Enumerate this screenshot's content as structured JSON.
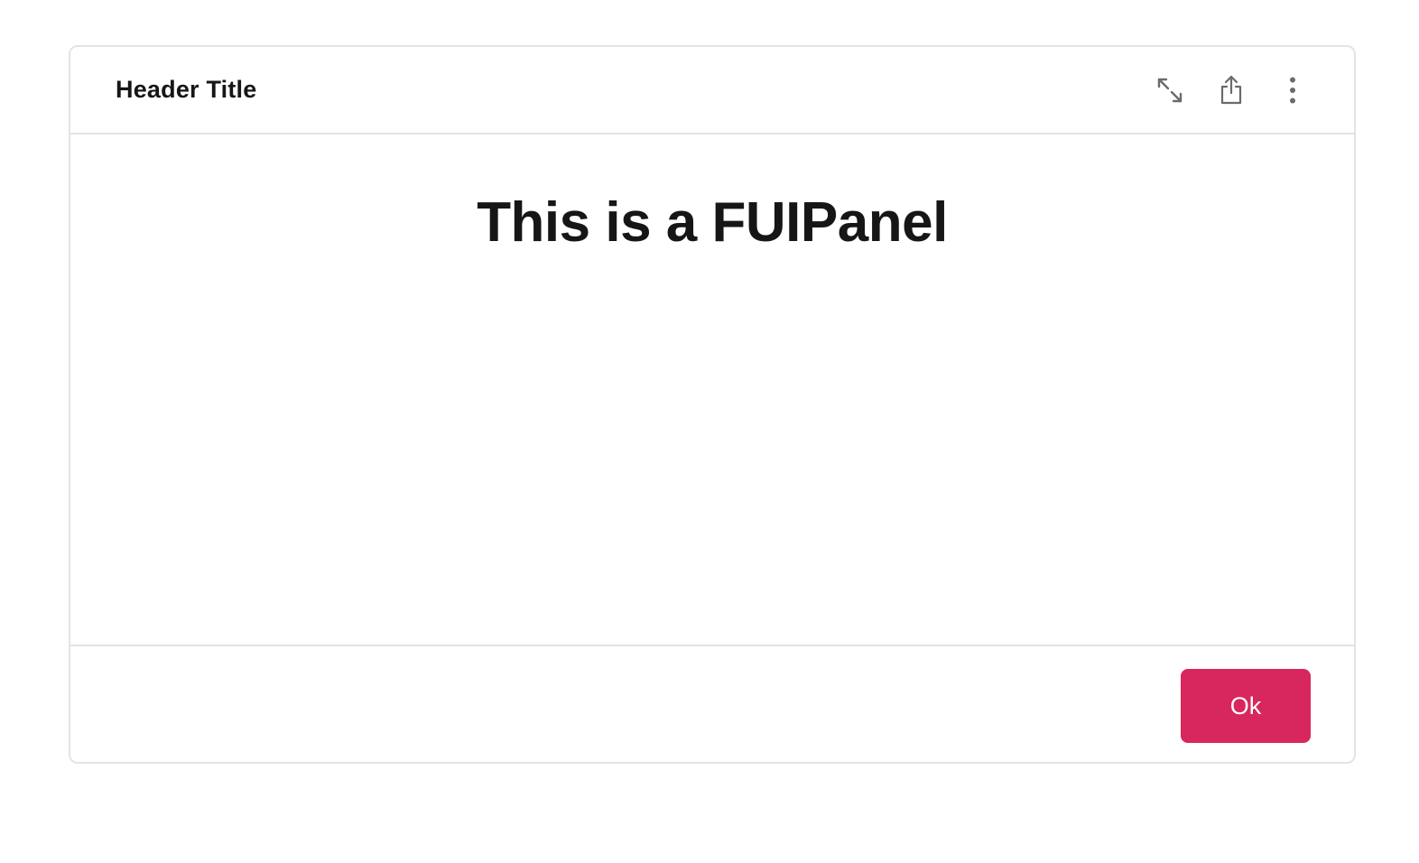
{
  "panel": {
    "header": {
      "title": "Header Title",
      "actions": [
        {
          "icon": "expand-icon"
        },
        {
          "icon": "share-icon"
        },
        {
          "icon": "more-vertical-icon"
        }
      ]
    },
    "body": {
      "heading": "This is a FUIPanel"
    },
    "footer": {
      "ok_label": "Ok"
    }
  },
  "colors": {
    "accent": "#d8275d",
    "border": "#e3e3e3",
    "text": "#161616",
    "icon": "#6b6b6b"
  }
}
